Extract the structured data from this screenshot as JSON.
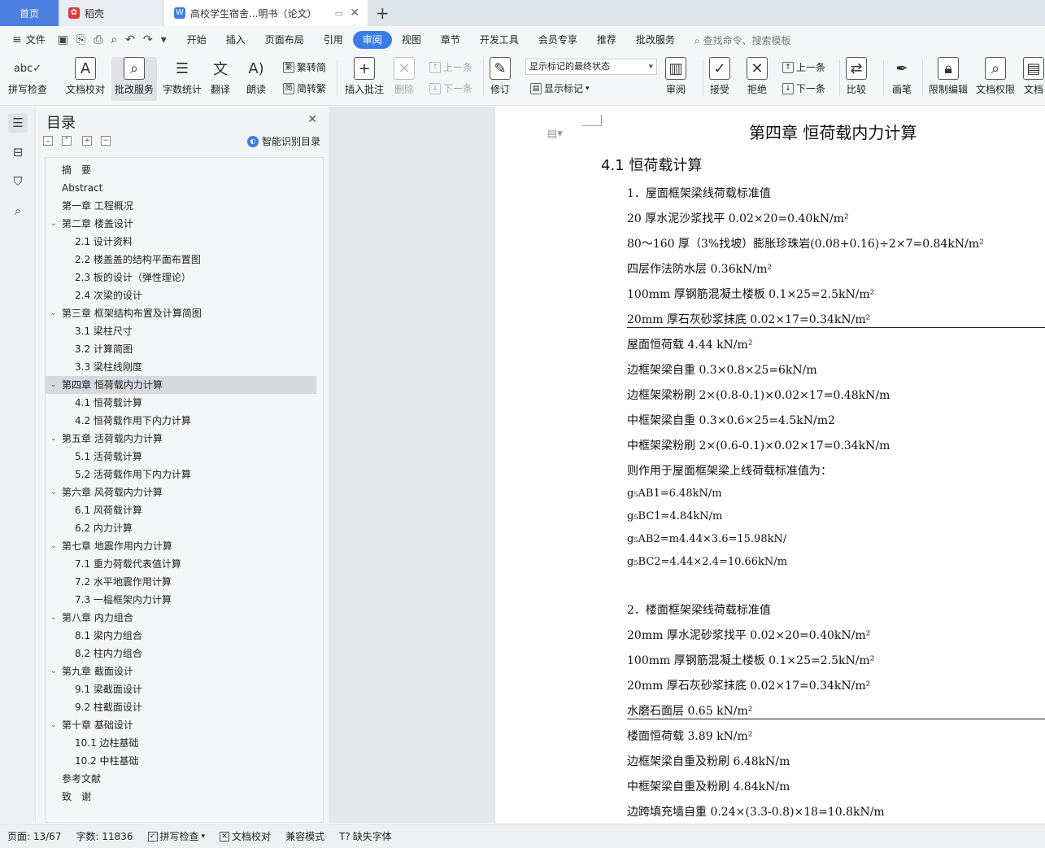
{
  "tabs": {
    "home": "首页",
    "daoke": "稻壳",
    "doc": "高校学生宿舍...明书（论文）",
    "add": "+"
  },
  "menu": {
    "file": "文件",
    "items": [
      "开始",
      "插入",
      "页面布局",
      "引用",
      "审阅",
      "视图",
      "章节",
      "开发工具",
      "会员专享",
      "推荐",
      "批改服务"
    ],
    "active_index": 4,
    "search": "查找命令、搜索模板"
  },
  "ribbon": {
    "spell": "拼写检查",
    "proofread": "文档校对",
    "correction": "批改服务",
    "wordcount": "字数统计",
    "translate": "翻译",
    "read": "朗读",
    "trad_simp": "繁转简",
    "simp_trad": "简转繁",
    "insert_comment": "插入批注",
    "delete": "删除",
    "prev": "上一条",
    "next": "下一条",
    "revise": "修订",
    "markup_state": "显示标记的最终状态",
    "show_markup": "显示标记",
    "review": "审阅",
    "accept": "接受",
    "reject": "拒绝",
    "prev2": "上一条",
    "next2": "下一条",
    "compare": "比较",
    "pen": "画笔",
    "restrict": "限制编辑",
    "doc_rights": "文档权限",
    "doc_more": "文档"
  },
  "nav": {
    "title": "目录",
    "smart": "智能识别目录",
    "items": [
      {
        "label": "摘　要",
        "level": 1
      },
      {
        "label": "Abstract",
        "level": 1
      },
      {
        "label": "第一章  工程概况",
        "level": 1
      },
      {
        "label": "第二章  楼盖设计",
        "level": 1,
        "expanded": true
      },
      {
        "label": "2.1  设计资料",
        "level": 2
      },
      {
        "label": "2.2  楼盖盖的结构平面布置图",
        "level": 2
      },
      {
        "label": "2.3  板的设计（弹性理论）",
        "level": 2
      },
      {
        "label": "2.4  次梁的设计",
        "level": 2
      },
      {
        "label": "第三章  框架结构布置及计算简图",
        "level": 1,
        "expanded": true
      },
      {
        "label": "3.1  梁柱尺寸",
        "level": 2
      },
      {
        "label": "3.2  计算简图",
        "level": 2
      },
      {
        "label": "3.3  梁柱线刚度",
        "level": 2
      },
      {
        "label": "第四章  恒荷载内力计算",
        "level": 1,
        "expanded": true,
        "selected": true
      },
      {
        "label": "4.1  恒荷载计算",
        "level": 2
      },
      {
        "label": "4.2  恒荷载作用下内力计算",
        "level": 2
      },
      {
        "label": "第五章  活荷载内力计算",
        "level": 1,
        "expanded": true
      },
      {
        "label": "5.1  活荷载计算",
        "level": 2
      },
      {
        "label": "5.2  活荷载作用下内力计算",
        "level": 2
      },
      {
        "label": "第六章  风荷载内力计算",
        "level": 1,
        "expanded": true
      },
      {
        "label": "6.1  风荷载计算",
        "level": 2
      },
      {
        "label": "6.2  内力计算",
        "level": 2
      },
      {
        "label": "第七章  地震作用内力计算",
        "level": 1,
        "expanded": true
      },
      {
        "label": "7.1  重力荷载代表值计算",
        "level": 2
      },
      {
        "label": "7.2  水平地震作用计算",
        "level": 2
      },
      {
        "label": "7.3  一榀框架内力计算",
        "level": 2
      },
      {
        "label": "第八章  内力组合",
        "level": 1,
        "expanded": true
      },
      {
        "label": "8.1  梁内力组合",
        "level": 2
      },
      {
        "label": "8.2  柱内力组合",
        "level": 2
      },
      {
        "label": "第九章  截面设计",
        "level": 1,
        "expanded": true
      },
      {
        "label": "9.1  梁截面设计",
        "level": 2
      },
      {
        "label": "9.2  柱截面设计",
        "level": 2
      },
      {
        "label": "第十章  基础设计",
        "level": 1,
        "expanded": true
      },
      {
        "label": "10.1  边柱基础",
        "level": 2
      },
      {
        "label": "10.2  中柱基础",
        "level": 2
      },
      {
        "label": "参考文献",
        "level": 1
      },
      {
        "label": "致　谢",
        "level": 1
      }
    ]
  },
  "doc": {
    "chapter": "第四章  恒荷载内力计算",
    "section": "4.1  恒荷载计算",
    "lines": [
      {
        "t": "1．屋面框架梁线荷载标准值"
      },
      {
        "t": "20 厚水泥沙浆找平  0.02×20=0.40kN/m²"
      },
      {
        "t": "80～160 厚（3%找坡）膨胀珍珠岩(0.08+0.16)÷2×7=0.84kN/m²"
      },
      {
        "t": "四层作法防水层  0.36kN/m²"
      },
      {
        "t": "100mm 厚钢筋混凝土楼板  0.1×25=2.5kN/m²"
      },
      {
        "t": "20mm 厚石灰砂浆抹底  0.02×17=0.34kN/m²",
        "underline": true
      },
      {
        "t": "屋面恒荷载  4.44 kN/m²"
      },
      {
        "t": "边框架梁自重  0.3×0.8×25=6kN/m"
      },
      {
        "t": "边框架梁粉刷  2×(0.8-0.1)×0.02×17=0.48kN/m"
      },
      {
        "t": "中框架梁自重  0.3×0.6×25=4.5kN/m2"
      },
      {
        "t": "中框架梁粉刷  2×(0.6-0.1)×0.02×17=0.34kN/m"
      },
      {
        "t": "则作用于屋面框架梁上线荷载标准值为："
      },
      {
        "t": "g₅AB1=6.48kN/m",
        "sub": true
      },
      {
        "t": "g₅BC1=4.84kN/m",
        "sub": true
      },
      {
        "t": "g₅AB2=m4.44×3.6=15.98kN/",
        "sub": true
      },
      {
        "t": "g₅BC2=4.44×2.4=10.66kN/m",
        "sub": true
      },
      {
        "t": "2．楼面框架梁线荷载标准值"
      },
      {
        "t": "20mm 厚水泥砂浆找平  0.02×20=0.40kN/m²"
      },
      {
        "t": "100mm 厚钢筋混凝土楼板  0.1×25=2.5kN/m²"
      },
      {
        "t": "20mm 厚石灰砂浆抹底  0.02×17=0.34kN/m²"
      },
      {
        "t": "水磨石面层  0.65 kN/m²",
        "underline": true
      },
      {
        "t": "楼面恒荷载  3.89 kN/m²"
      },
      {
        "t": "边框架梁自重及粉刷  6.48kN/m"
      },
      {
        "t": "中框架梁自重及粉刷  4.84kN/m"
      },
      {
        "t": "边跨填充墙自重  0.24×(3.3-0.8)×18=10.8kN/m"
      }
    ]
  },
  "status": {
    "page": "页面: 13/67",
    "words": "字数: 11836",
    "spell": "拼写检查",
    "proof": "文档校对",
    "compat": "兼容模式",
    "font": "缺失字体"
  }
}
